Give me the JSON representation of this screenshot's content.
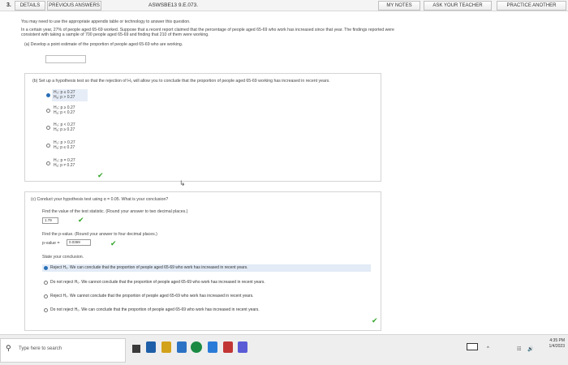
{
  "header": {
    "question_number": "3.",
    "details": "DETAILS",
    "previous_answers": "PREVIOUS ANSWERS",
    "question_code": "ASWSBE13 9.E.073.",
    "my_notes": "MY NOTES",
    "ask_teacher": "ASK YOUR TEACHER",
    "practice_another": "PRACTICE ANOTHER"
  },
  "intro": {
    "instructions": "You may need to use the appropriate appendix table or technology to answer this question.",
    "problem_line1": "In a certain year, 27% of people aged 65-69 worked. Suppose that a recent report claimed that the percentage of people aged 65-69 who work has increased since that year. The findings reported were",
    "problem_line2": "consistent with taking a sample of 700 people aged 65-69 and finding that 210 of them were working."
  },
  "part_a": {
    "prompt": "(a)  Develop a point estimate of the proportion of people aged 65-69 who are working.",
    "answer": ""
  },
  "part_b": {
    "prompt": "(b)  Set up a hypothesis test so that the rejection of H₀ will allow you to conclude that the proportion of people aged 65-69 working has increased in recent years.",
    "options": [
      {
        "h0": "H₀: p ≤ 0.27",
        "ha": "Hₐ: p > 0.27"
      },
      {
        "h0": "H₀: p ≥ 0.27",
        "ha": "Hₐ: p < 0.27"
      },
      {
        "h0": "H₀: p < 0.27",
        "ha": "Hₐ: p ≥ 0.27"
      },
      {
        "h0": "H₀: p > 0.27",
        "ha": "Hₐ: p ≤ 0.27"
      },
      {
        "h0": "H₀: p = 0.27",
        "ha": "Hₐ: p ≠ 0.27"
      }
    ],
    "selected_index": 0
  },
  "part_c": {
    "prompt": "(c)  Conduct your hypothesis test using α = 0.05. What is your conclusion?",
    "test_stat_prompt": "Find the value of the test statistic. (Round your answer to two decimal places.)",
    "test_stat_value": "1.79",
    "pvalue_prompt": "Find the p-value. (Round your answer to four decimal places.)",
    "pvalue_label": "p-value =",
    "pvalue_value": "0.0369",
    "state_label": "State your conclusion.",
    "conclusions": [
      "Reject H₀. We can conclude that the proportion of people aged 65-69 who work has increased in recent years.",
      "Do not reject H₀. We cannot conclude that the proportion of people aged 65-69 who work has increased in recent years.",
      "Reject H₀. We cannot conclude that the proportion of people aged 65-69 who work has increased in recent years.",
      "Do not reject H₀. We can conclude that the proportion of people aged 65-69 who work has increased in recent years."
    ],
    "selected_index": 0
  },
  "taskbar": {
    "search_placeholder": "Type here to search",
    "time": "4:35 PM",
    "date": "1/4/2023"
  },
  "colors": {
    "accent": "#2a6fb7",
    "check": "#34a52a"
  }
}
